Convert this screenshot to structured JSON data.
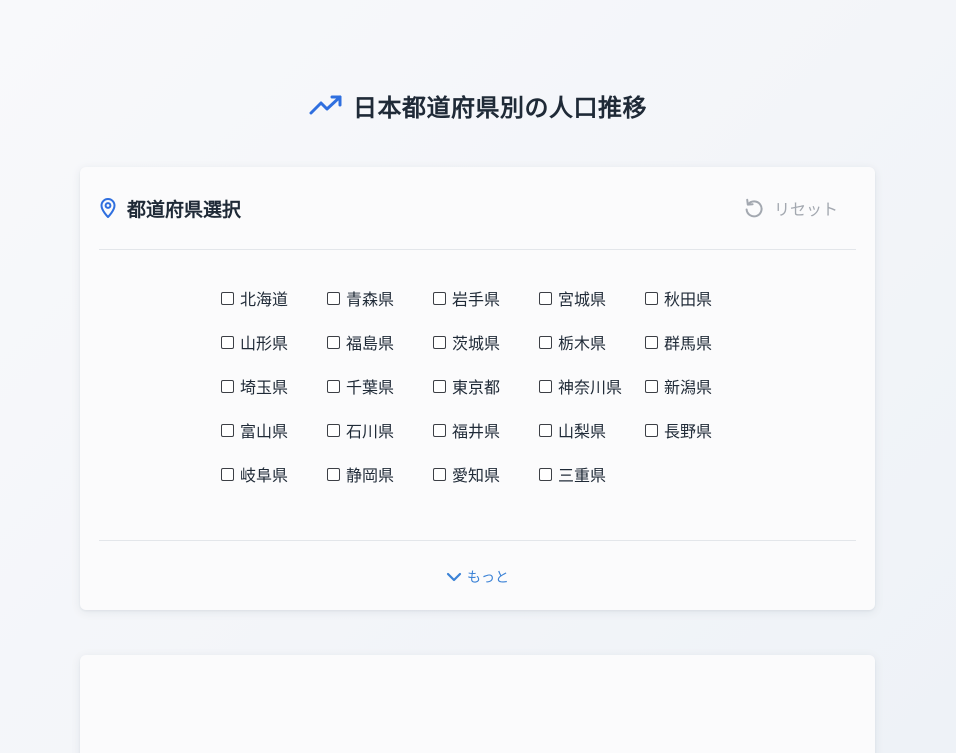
{
  "page": {
    "title": "日本都道府県別の人口推移",
    "title_icon": "trending-up-icon",
    "accent_color": "#2f6fdf"
  },
  "selector": {
    "header_icon": "map-pin-icon",
    "title": "都道府県選択",
    "reset_label": "リセット",
    "reset_icon": "reset-icon",
    "more_label": "もっと",
    "more_icon": "chevron-down-icon",
    "prefectures": [
      {
        "name": "北海道",
        "checked": false
      },
      {
        "name": "青森県",
        "checked": false
      },
      {
        "name": "岩手県",
        "checked": false
      },
      {
        "name": "宮城県",
        "checked": false
      },
      {
        "name": "秋田県",
        "checked": false
      },
      {
        "name": "山形県",
        "checked": false
      },
      {
        "name": "福島県",
        "checked": false
      },
      {
        "name": "茨城県",
        "checked": false
      },
      {
        "name": "栃木県",
        "checked": false
      },
      {
        "name": "群馬県",
        "checked": false
      },
      {
        "name": "埼玉県",
        "checked": false
      },
      {
        "name": "千葉県",
        "checked": false
      },
      {
        "name": "東京都",
        "checked": false
      },
      {
        "name": "神奈川県",
        "checked": false
      },
      {
        "name": "新潟県",
        "checked": false
      },
      {
        "name": "富山県",
        "checked": false
      },
      {
        "name": "石川県",
        "checked": false
      },
      {
        "name": "福井県",
        "checked": false
      },
      {
        "name": "山梨県",
        "checked": false
      },
      {
        "name": "長野県",
        "checked": false
      },
      {
        "name": "岐阜県",
        "checked": false
      },
      {
        "name": "静岡県",
        "checked": false
      },
      {
        "name": "愛知県",
        "checked": false
      },
      {
        "name": "三重県",
        "checked": false
      }
    ]
  }
}
